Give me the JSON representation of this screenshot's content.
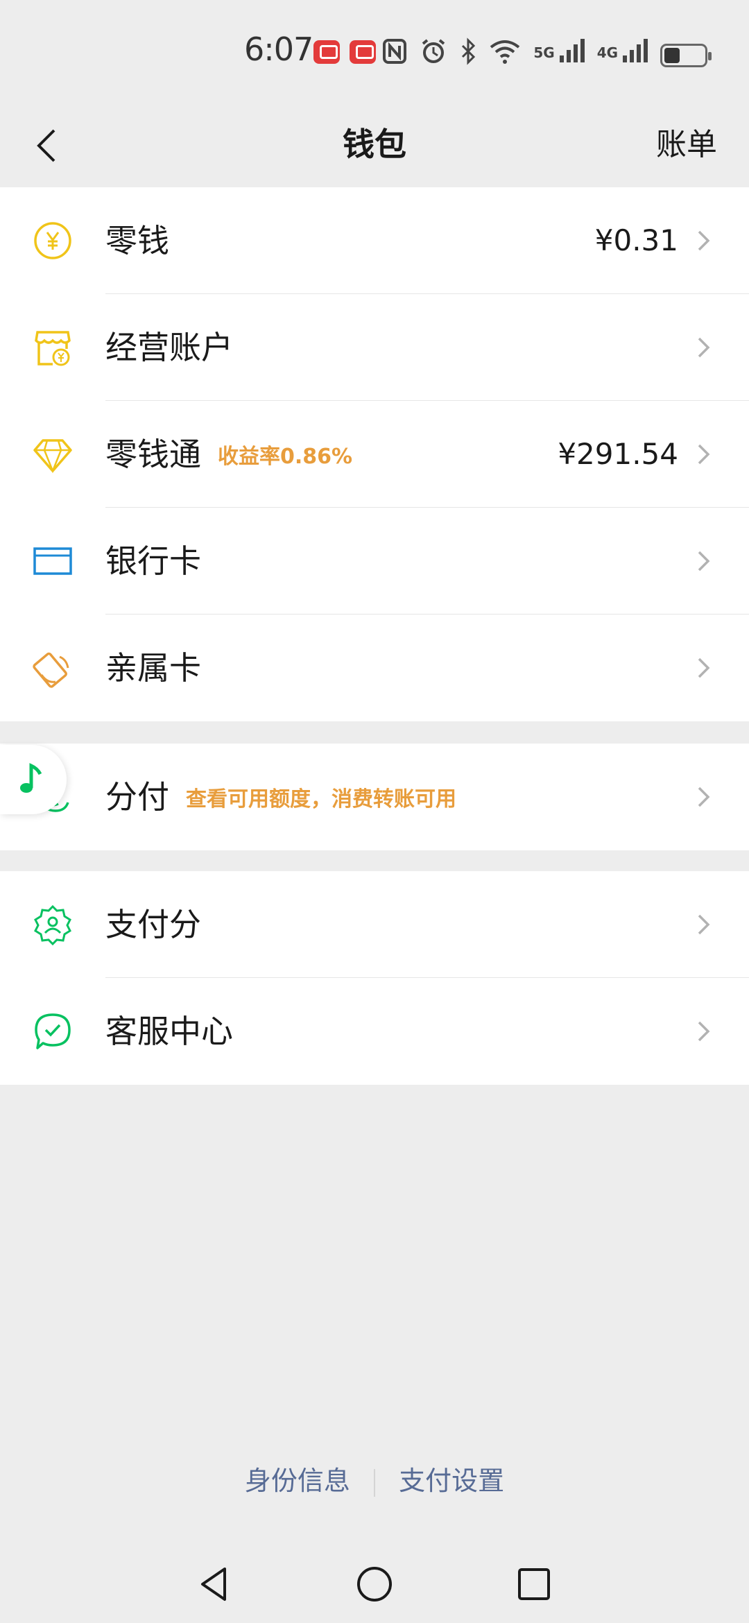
{
  "status_bar": {
    "time": "6:07",
    "network_5g": "5G",
    "network_4g": "4G"
  },
  "header": {
    "title": "钱包",
    "bill_label": "账单"
  },
  "wallet_items": [
    {
      "label": "零钱",
      "value": "¥0.31"
    },
    {
      "label": "经营账户"
    },
    {
      "label": "零钱通",
      "tag": "收益率0.86%",
      "value": "¥291.54"
    },
    {
      "label": "银行卡"
    },
    {
      "label": "亲属卡"
    }
  ],
  "fenfu": {
    "label": "分付",
    "tag": "查看可用额度，消费转账可用"
  },
  "services": [
    {
      "label": "支付分"
    },
    {
      "label": "客服中心"
    }
  ],
  "footer": {
    "identity": "身份信息",
    "pay_settings": "支付设置"
  },
  "colors": {
    "accent_orange": "#e89d3c",
    "yellow_icon": "#f0c419",
    "blue_icon": "#1e8ad6",
    "green_icon": "#07c160",
    "link_blue": "#576b95"
  }
}
